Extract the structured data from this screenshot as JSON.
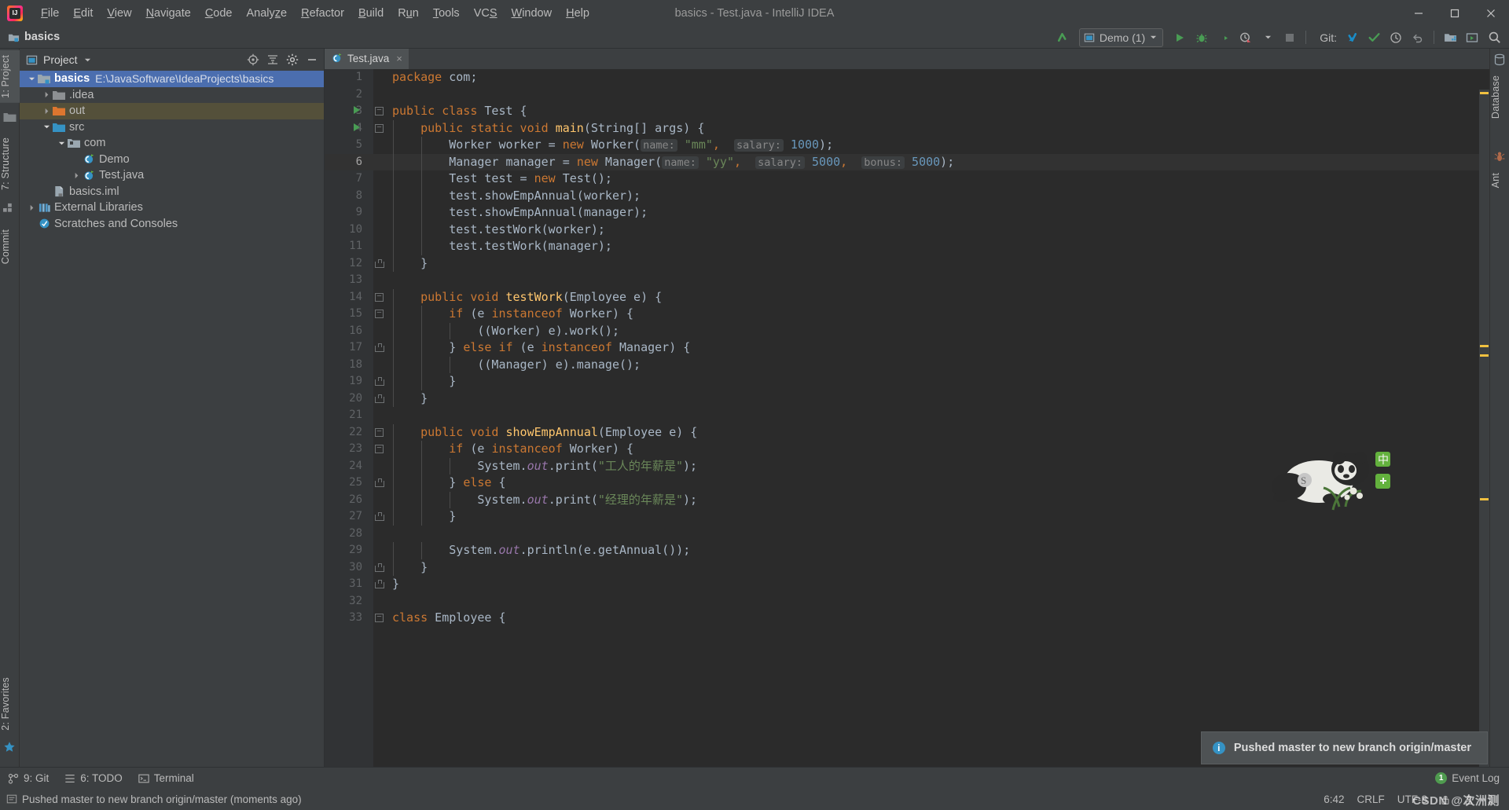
{
  "window": {
    "title": "basics - Test.java - IntelliJ IDEA",
    "minimize_label": "—",
    "maximize_label": "❑",
    "close_label": "✕"
  },
  "menubar": {
    "items": [
      {
        "label": "File",
        "mnemonic": "F"
      },
      {
        "label": "Edit",
        "mnemonic": "E"
      },
      {
        "label": "View",
        "mnemonic": "V"
      },
      {
        "label": "Navigate",
        "mnemonic": "N"
      },
      {
        "label": "Code",
        "mnemonic": "C"
      },
      {
        "label": "Analyze",
        "mnemonic": "z"
      },
      {
        "label": "Refactor",
        "mnemonic": "R"
      },
      {
        "label": "Build",
        "mnemonic": "B"
      },
      {
        "label": "Run",
        "mnemonic": "u"
      },
      {
        "label": "Tools",
        "mnemonic": "T"
      },
      {
        "label": "VCS",
        "mnemonic": "S"
      },
      {
        "label": "Window",
        "mnemonic": "W"
      },
      {
        "label": "Help",
        "mnemonic": "H"
      }
    ]
  },
  "navbar": {
    "breadcrumb": "basics",
    "run_config": "Demo (1)",
    "git_label": "Git:"
  },
  "left_stripe": {
    "project_tab": "1: Project",
    "structure_tab": "7: Structure",
    "commit_tab": "Commit",
    "favorites_tab": "2: Favorites"
  },
  "right_stripe": {
    "database_tab": "Database",
    "ant_tab": "Ant"
  },
  "project_panel": {
    "title": "Project",
    "tree": [
      {
        "depth": 0,
        "twist": "down",
        "icon": "module-icon",
        "name": "basics",
        "bold": true,
        "path": "E:\\JavaSoftware\\IdeaProjects\\basics",
        "state": "selected"
      },
      {
        "depth": 1,
        "twist": "right",
        "icon": "folder-icon",
        "name": ".idea",
        "bold": false,
        "path": "",
        "state": "normal"
      },
      {
        "depth": 1,
        "twist": "right",
        "icon": "folder-out-icon",
        "name": "out",
        "bold": false,
        "path": "",
        "state": "highlighted"
      },
      {
        "depth": 1,
        "twist": "down",
        "icon": "folder-src-icon",
        "name": "src",
        "bold": false,
        "path": "",
        "state": "normal"
      },
      {
        "depth": 2,
        "twist": "down",
        "icon": "package-icon",
        "name": "com",
        "bold": false,
        "path": "",
        "state": "normal"
      },
      {
        "depth": 3,
        "twist": "none",
        "icon": "class-icon",
        "name": "Demo",
        "bold": false,
        "path": "",
        "state": "normal"
      },
      {
        "depth": 3,
        "twist": "right",
        "icon": "class-icon",
        "name": "Test.java",
        "bold": false,
        "path": "",
        "state": "normal"
      },
      {
        "depth": 1,
        "twist": "none",
        "icon": "iml-icon",
        "name": "basics.iml",
        "bold": false,
        "path": "",
        "state": "normal"
      },
      {
        "depth": 0,
        "twist": "right",
        "icon": "libraries-icon",
        "name": "External Libraries",
        "bold": false,
        "path": "",
        "state": "normal"
      },
      {
        "depth": 0,
        "twist": "none",
        "icon": "scratches-icon",
        "name": "Scratches and Consoles",
        "bold": false,
        "path": "",
        "state": "normal"
      }
    ]
  },
  "editor": {
    "tab": {
      "label": "Test.java",
      "close": "×"
    },
    "current_line": 6,
    "lines": [
      {
        "n": 1,
        "indent": 0,
        "run": false,
        "fold": "",
        "tokens": [
          {
            "t": "kw",
            "v": "package"
          },
          {
            "t": "pln",
            "v": " com;"
          }
        ]
      },
      {
        "n": 2,
        "indent": 0,
        "run": false,
        "fold": "",
        "tokens": []
      },
      {
        "n": 3,
        "indent": 0,
        "run": true,
        "fold": "minus",
        "tokens": [
          {
            "t": "kw",
            "v": "public class"
          },
          {
            "t": "pln",
            "v": " "
          },
          {
            "t": "pln",
            "v": "Test {"
          }
        ]
      },
      {
        "n": 4,
        "indent": 1,
        "run": true,
        "fold": "minus",
        "tokens": [
          {
            "t": "kw",
            "v": "public static void"
          },
          {
            "t": "pln",
            "v": " "
          },
          {
            "t": "meth",
            "v": "main"
          },
          {
            "t": "pln",
            "v": "(String[] args) {"
          }
        ]
      },
      {
        "n": 5,
        "indent": 2,
        "run": false,
        "fold": "",
        "tokens": [
          {
            "t": "pln",
            "v": "Worker worker = "
          },
          {
            "t": "kw",
            "v": "new"
          },
          {
            "t": "pln",
            "v": " Worker("
          },
          {
            "t": "hint",
            "v": "name:"
          },
          {
            "t": "pln",
            "v": " "
          },
          {
            "t": "str",
            "v": "\"mm\""
          },
          {
            "t": "kw",
            "v": ","
          },
          {
            "t": "pln",
            "v": "  "
          },
          {
            "t": "hint",
            "v": "salary:"
          },
          {
            "t": "pln",
            "v": " "
          },
          {
            "t": "num",
            "v": "1000"
          },
          {
            "t": "pln",
            "v": ");"
          }
        ]
      },
      {
        "n": 6,
        "indent": 2,
        "run": false,
        "fold": "",
        "tokens": [
          {
            "t": "pln",
            "v": "Manager manager = "
          },
          {
            "t": "kw",
            "v": "new"
          },
          {
            "t": "pln",
            "v": " Manager("
          },
          {
            "t": "hint",
            "v": "name:"
          },
          {
            "t": "pln",
            "v": " "
          },
          {
            "t": "str",
            "v": "\"yy\""
          },
          {
            "t": "kw",
            "v": ","
          },
          {
            "t": "pln",
            "v": "  "
          },
          {
            "t": "hint",
            "v": "salary:"
          },
          {
            "t": "pln",
            "v": " "
          },
          {
            "t": "num",
            "v": "5000"
          },
          {
            "t": "kw",
            "v": ","
          },
          {
            "t": "pln",
            "v": "  "
          },
          {
            "t": "hint",
            "v": "bonus:"
          },
          {
            "t": "pln",
            "v": " "
          },
          {
            "t": "num",
            "v": "5000"
          },
          {
            "t": "pln",
            "v": ");"
          }
        ]
      },
      {
        "n": 7,
        "indent": 2,
        "run": false,
        "fold": "",
        "tokens": [
          {
            "t": "pln",
            "v": "Test test = "
          },
          {
            "t": "kw",
            "v": "new"
          },
          {
            "t": "pln",
            "v": " Test();"
          }
        ]
      },
      {
        "n": 8,
        "indent": 2,
        "run": false,
        "fold": "",
        "tokens": [
          {
            "t": "pln",
            "v": "test.showEmpAnnual(worker);"
          }
        ]
      },
      {
        "n": 9,
        "indent": 2,
        "run": false,
        "fold": "",
        "tokens": [
          {
            "t": "pln",
            "v": "test.showEmpAnnual(manager);"
          }
        ]
      },
      {
        "n": 10,
        "indent": 2,
        "run": false,
        "fold": "",
        "tokens": [
          {
            "t": "pln",
            "v": "test.testWork(worker);"
          }
        ]
      },
      {
        "n": 11,
        "indent": 2,
        "run": false,
        "fold": "",
        "tokens": [
          {
            "t": "pln",
            "v": "test.testWork(manager);"
          }
        ]
      },
      {
        "n": 12,
        "indent": 1,
        "run": false,
        "fold": "end",
        "tokens": [
          {
            "t": "pln",
            "v": "}"
          }
        ]
      },
      {
        "n": 13,
        "indent": 0,
        "run": false,
        "fold": "",
        "tokens": []
      },
      {
        "n": 14,
        "indent": 1,
        "run": false,
        "fold": "minus",
        "tokens": [
          {
            "t": "kw",
            "v": "public void"
          },
          {
            "t": "pln",
            "v": " "
          },
          {
            "t": "meth",
            "v": "testWork"
          },
          {
            "t": "pln",
            "v": "(Employee e) {"
          }
        ]
      },
      {
        "n": 15,
        "indent": 2,
        "run": false,
        "fold": "minus",
        "tokens": [
          {
            "t": "kw",
            "v": "if"
          },
          {
            "t": "pln",
            "v": " (e "
          },
          {
            "t": "kw",
            "v": "instanceof"
          },
          {
            "t": "pln",
            "v": " Worker) {"
          }
        ]
      },
      {
        "n": 16,
        "indent": 3,
        "run": false,
        "fold": "",
        "tokens": [
          {
            "t": "pln",
            "v": "((Worker) e).work();"
          }
        ]
      },
      {
        "n": 17,
        "indent": 2,
        "run": false,
        "fold": "end",
        "tokens": [
          {
            "t": "pln",
            "v": "} "
          },
          {
            "t": "kw",
            "v": "else if"
          },
          {
            "t": "pln",
            "v": " (e "
          },
          {
            "t": "kw",
            "v": "instanceof"
          },
          {
            "t": "pln",
            "v": " Manager) {"
          }
        ]
      },
      {
        "n": 18,
        "indent": 3,
        "run": false,
        "fold": "",
        "tokens": [
          {
            "t": "pln",
            "v": "((Manager) e).manage();"
          }
        ]
      },
      {
        "n": 19,
        "indent": 2,
        "run": false,
        "fold": "end",
        "tokens": [
          {
            "t": "pln",
            "v": "}"
          }
        ]
      },
      {
        "n": 20,
        "indent": 1,
        "run": false,
        "fold": "end",
        "tokens": [
          {
            "t": "pln",
            "v": "}"
          }
        ]
      },
      {
        "n": 21,
        "indent": 0,
        "run": false,
        "fold": "",
        "tokens": []
      },
      {
        "n": 22,
        "indent": 1,
        "run": false,
        "fold": "minus",
        "tokens": [
          {
            "t": "kw",
            "v": "public void"
          },
          {
            "t": "pln",
            "v": " "
          },
          {
            "t": "meth",
            "v": "showEmpAnnual"
          },
          {
            "t": "pln",
            "v": "(Employee e) {"
          }
        ]
      },
      {
        "n": 23,
        "indent": 2,
        "run": false,
        "fold": "minus",
        "tokens": [
          {
            "t": "kw",
            "v": "if"
          },
          {
            "t": "pln",
            "v": " (e "
          },
          {
            "t": "kw",
            "v": "instanceof"
          },
          {
            "t": "pln",
            "v": " Worker) {"
          }
        ]
      },
      {
        "n": 24,
        "indent": 3,
        "run": false,
        "fold": "",
        "tokens": [
          {
            "t": "pln",
            "v": "System."
          },
          {
            "t": "fld",
            "v": "out"
          },
          {
            "t": "pln",
            "v": ".print("
          },
          {
            "t": "str",
            "v": "\"工人的年薪是\""
          },
          {
            "t": "pln",
            "v": ");"
          }
        ]
      },
      {
        "n": 25,
        "indent": 2,
        "run": false,
        "fold": "end",
        "tokens": [
          {
            "t": "pln",
            "v": "} "
          },
          {
            "t": "kw",
            "v": "else"
          },
          {
            "t": "pln",
            "v": " {"
          }
        ]
      },
      {
        "n": 26,
        "indent": 3,
        "run": false,
        "fold": "",
        "tokens": [
          {
            "t": "pln",
            "v": "System."
          },
          {
            "t": "fld",
            "v": "out"
          },
          {
            "t": "pln",
            "v": ".print("
          },
          {
            "t": "str",
            "v": "\"经理的年薪是\""
          },
          {
            "t": "pln",
            "v": ");"
          }
        ]
      },
      {
        "n": 27,
        "indent": 2,
        "run": false,
        "fold": "end",
        "tokens": [
          {
            "t": "pln",
            "v": "}"
          }
        ]
      },
      {
        "n": 28,
        "indent": 0,
        "run": false,
        "fold": "",
        "tokens": []
      },
      {
        "n": 29,
        "indent": 2,
        "run": false,
        "fold": "",
        "tokens": [
          {
            "t": "pln",
            "v": "System."
          },
          {
            "t": "fld",
            "v": "out"
          },
          {
            "t": "pln",
            "v": ".println(e.getAnnual());"
          }
        ]
      },
      {
        "n": 30,
        "indent": 1,
        "run": false,
        "fold": "end",
        "tokens": [
          {
            "t": "pln",
            "v": "}"
          }
        ]
      },
      {
        "n": 31,
        "indent": 0,
        "run": false,
        "fold": "end",
        "tokens": [
          {
            "t": "pln",
            "v": "}"
          }
        ]
      },
      {
        "n": 32,
        "indent": 0,
        "run": false,
        "fold": "",
        "tokens": []
      },
      {
        "n": 33,
        "indent": 0,
        "run": false,
        "fold": "minus",
        "tokens": [
          {
            "t": "kw",
            "v": "class"
          },
          {
            "t": "pln",
            "v": " Employee {"
          }
        ]
      }
    ]
  },
  "notification": {
    "text": "Pushed master to new branch origin/master",
    "icon": "info-icon"
  },
  "bottom_bar": {
    "items": [
      {
        "label": "9: Git",
        "mnemonic": "9",
        "icon": "git-icon"
      },
      {
        "label": "6: TODO",
        "mnemonic": "6",
        "icon": "todo-icon"
      },
      {
        "label": "Terminal",
        "mnemonic": "",
        "icon": "terminal-icon"
      }
    ],
    "event_log": "Event Log",
    "event_count": "1"
  },
  "statusbar": {
    "message": "Pushed master to new branch origin/master (moments ago)",
    "caret": "6:42",
    "line_sep": "CRLF",
    "encoding": "UTF-8",
    "lock": "lock-icon",
    "inspection": "inspector-icon",
    "branch": "git-branch-icon"
  },
  "watermark": {
    "text": "CSDN @次洲测"
  },
  "colors": {
    "accent_blue": "#4b6eaf",
    "editor_bg": "#2b2b2b",
    "panel_bg": "#3c3f41",
    "gutter_bg": "#313335",
    "keyword": "#cc7832",
    "string": "#6a8759",
    "number": "#6897bb",
    "method": "#ffc66d",
    "field": "#9876aa",
    "plain": "#a9b7c6",
    "run_green": "#499c54",
    "info_blue": "#3592c4"
  }
}
